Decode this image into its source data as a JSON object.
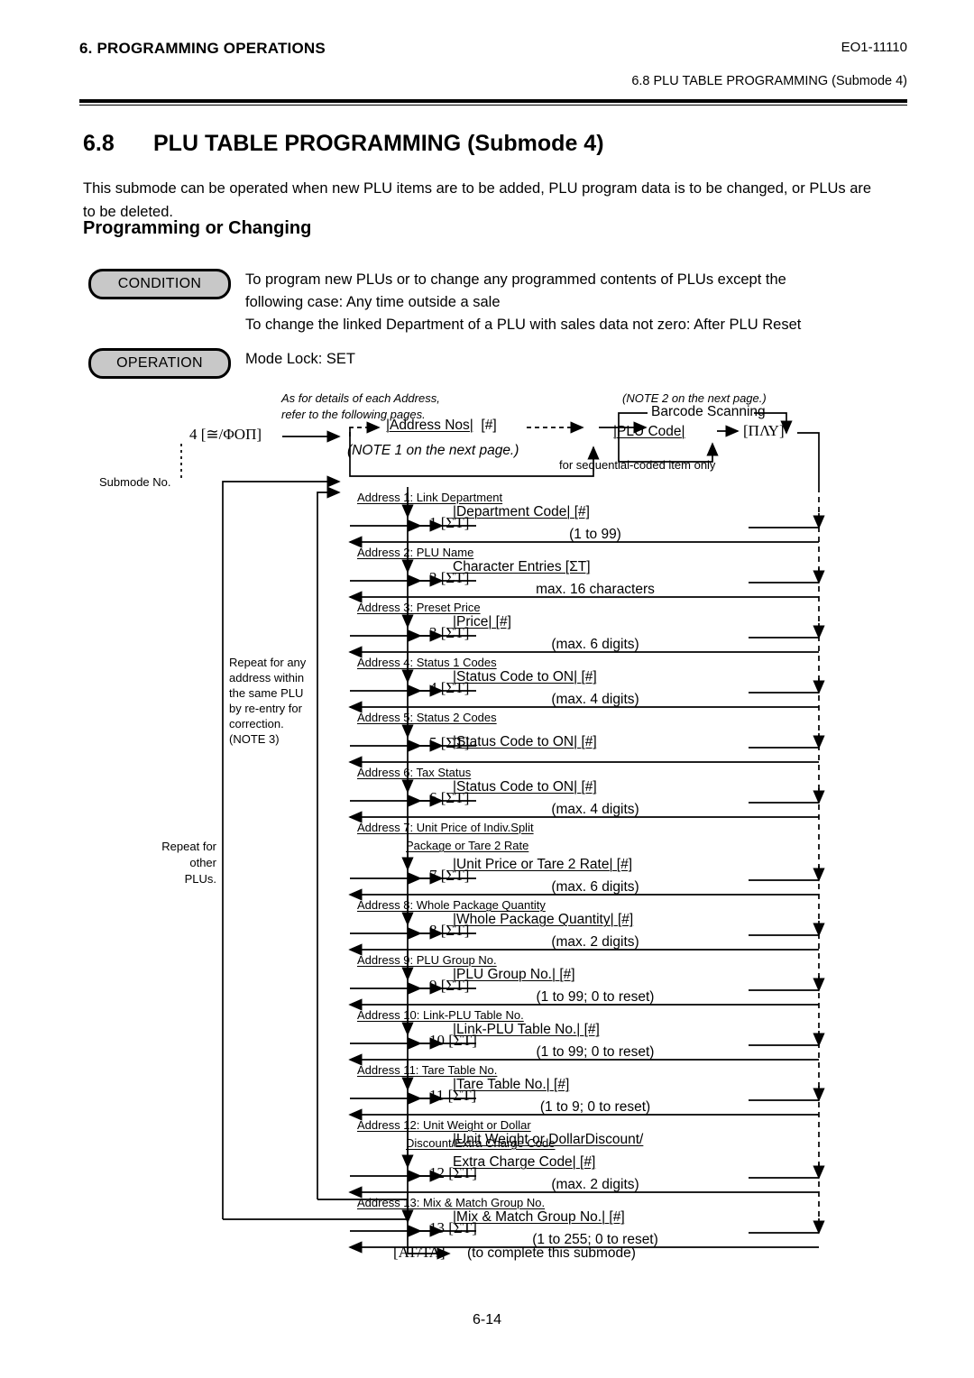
{
  "header": {
    "chapter": "6.  PROGRAMMING OPERATIONS",
    "doc_code": "EO1-11110",
    "section_ref": "6.8  PLU TABLE PROGRAMMING  (Submode 4)"
  },
  "title": {
    "number": "6.8",
    "text": "PLU TABLE PROGRAMMING  (Submode 4)"
  },
  "intro": "This submode can be operated when new PLU items are to be added, PLU program data is to be changed, or PLUs are to be deleted.",
  "subtitle": "Programming or Changing",
  "condition": {
    "label": "CONDITION",
    "line1": "To program new PLUs or to change any programmed contents of PLUs except the",
    "line2": "following case:  Any time outside a sale",
    "line3": "To change the linked Department of a PLU with sales data not zero:  After PLU Reset"
  },
  "operation": {
    "label": "OPERATION",
    "text": "Mode Lock:  SET"
  },
  "flow": {
    "start_key": "4 [≅/ΦΟΠ]",
    "submode_caption": "Submode No.",
    "address_note_1": "As for details of each Address,",
    "address_note_2": "refer to the following pages.",
    "address_entry": "|Address Nos|  [#]",
    "note1": "(NOTE 1 on the next page.)",
    "note2": "(NOTE 2 on the next page.)",
    "barcode_label": "Barcode Scanning",
    "plu_code": "|PLU Code|",
    "plu_key": "[ΠΛΥ]",
    "sequential_note": "for sequential-coded item only",
    "repeat_address_note": "Repeat for any\naddress within\nthe same PLU\nby re-entry for\ncorrection.",
    "repeat_address_note_lines": [
      "Repeat for any",
      "address within",
      "the same PLU",
      "by re-entry for",
      "correction."
    ],
    "note3": "(NOTE 3)",
    "repeat_plus_lines": [
      "Repeat for",
      "other",
      "PLUs."
    ],
    "complete_key": "[ΑΤ/ΤΛ]",
    "complete_text": "(to complete this submode)"
  },
  "addresses": [
    {
      "n": "1",
      "title_lines": [
        "Address 1:  Link Department"
      ],
      "key": "1  [ΣΤ]",
      "action_lines": [
        "|Department Code|  [#]"
      ],
      "range": "(1 to 99)"
    },
    {
      "n": "2",
      "title_lines": [
        "Address 2:  PLU Name"
      ],
      "key": "2  [ΣΤ]",
      "action_lines": [
        "Character Entries  [ΣΤ]"
      ],
      "range": "max. 16 characters"
    },
    {
      "n": "3",
      "title_lines": [
        "Address 3:  Preset Price"
      ],
      "key": "3  [ΣΤ]",
      "action_lines": [
        "|Price|  [#]"
      ],
      "range": "(max. 6 digits)"
    },
    {
      "n": "4",
      "title_lines": [
        "Address 4:  Status 1 Codes"
      ],
      "key": "4  [ΣΤ]",
      "action_lines": [
        "|Status Code to ON|  [#]"
      ],
      "range": "(max. 4 digits)"
    },
    {
      "n": "5",
      "title_lines": [
        "Address 5:  Status 2 Codes"
      ],
      "key": "5  [ΣΤ]",
      "action_lines": [
        "|Status Code to ON|  [#]"
      ],
      "range": ""
    },
    {
      "n": "6",
      "title_lines": [
        "Address 6:  Tax Status"
      ],
      "key": "6  [ΣΤ]",
      "action_lines": [
        "|Status Code to ON|  [#]"
      ],
      "range": "(max. 4 digits)"
    },
    {
      "n": "7",
      "title_lines": [
        "Address 7:  Unit Price of Indiv.Split",
        "Package or Tare 2 Rate"
      ],
      "key": "7  [ΣΤ]",
      "action_lines": [
        "|Unit Price or Tare 2 Rate|  [#]"
      ],
      "range": "(max. 6 digits)"
    },
    {
      "n": "8",
      "title_lines": [
        "Address 8:  Whole Package Quantity"
      ],
      "key": "8  [ΣΤ]",
      "action_lines": [
        "|Whole Package Quantity|  [#]"
      ],
      "range": "(max. 2 digits)"
    },
    {
      "n": "9",
      "title_lines": [
        "Address 9:  PLU Group No."
      ],
      "key": "9  [ΣΤ]",
      "action_lines": [
        "|PLU Group No.|  [#]"
      ],
      "range": "(1 to 99;  0 to reset)"
    },
    {
      "n": "10",
      "title_lines": [
        "Address 10:  Link-PLU Table No."
      ],
      "key": "10  [ΣΤ]",
      "action_lines": [
        "|Link-PLU Table No.|  [#]"
      ],
      "range": "(1 to 99;  0 to reset)"
    },
    {
      "n": "11",
      "title_lines": [
        "Address 11:  Tare Table No."
      ],
      "key": "11  [ΣΤ]",
      "action_lines": [
        "|Tare Table No.|  [#]"
      ],
      "range": "(1 to 9;  0 to reset)"
    },
    {
      "n": "12",
      "title_lines": [
        "Address 12:  Unit Weight or Dollar",
        "Discount/Extra Charge Code"
      ],
      "key": "12  [ΣΤ]",
      "action_lines": [
        "|Unit Weight or DollarDiscount/",
        "Extra Charge Code|  [#]"
      ],
      "range": "(max. 2 digits)"
    },
    {
      "n": "13",
      "title_lines": [
        "Address 13:  Mix & Match Group No."
      ],
      "key": "13  [ΣΤ]",
      "action_lines": [
        "|Mix & Match Group No.|  [#]"
      ],
      "range": "(1 to 255;  0 to reset)"
    }
  ],
  "footer": {
    "page": "6-14"
  }
}
